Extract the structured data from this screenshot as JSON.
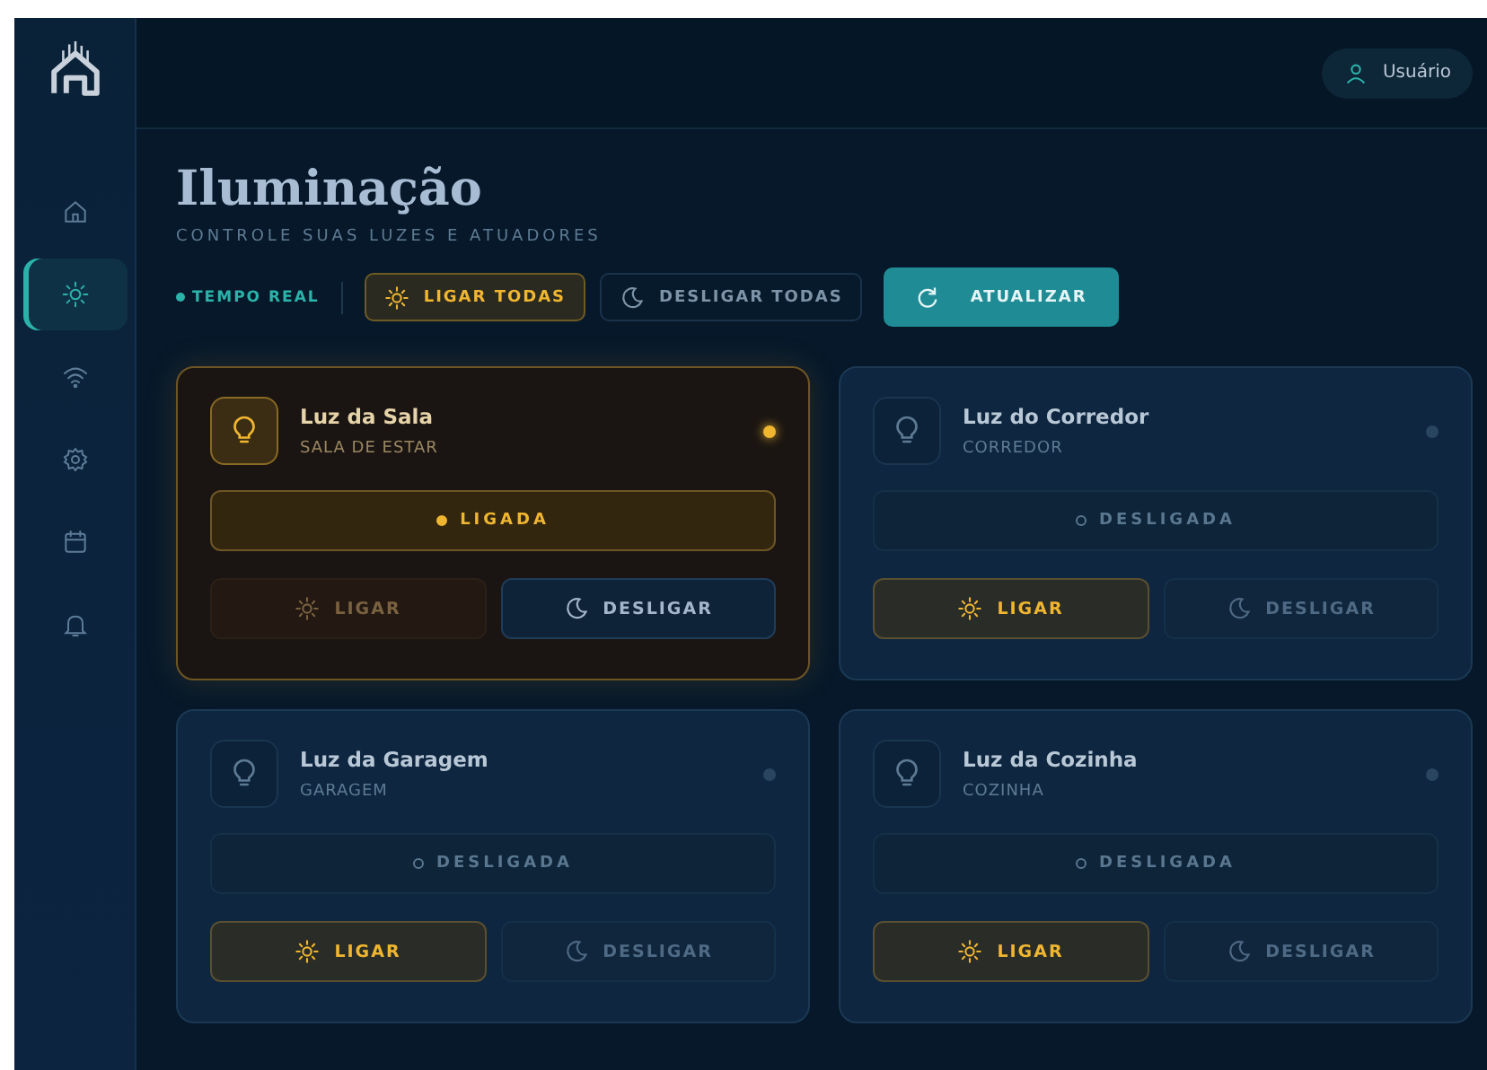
{
  "user_button": {
    "label": "Usuário"
  },
  "sidebar": {
    "items": [
      {
        "kind": "home",
        "selected": false
      },
      {
        "kind": "light",
        "selected": true
      },
      {
        "kind": "wifi",
        "selected": false
      },
      {
        "kind": "settings",
        "selected": false
      },
      {
        "kind": "calendar",
        "selected": false
      },
      {
        "kind": "bell",
        "selected": false
      }
    ]
  },
  "page": {
    "title": "Iluminação",
    "subtitle": "CONTROLE SUAS LUZES E ATUADORES"
  },
  "toolbar": {
    "live": "TEMPO REAL",
    "turn_all_on": "LIGAR TODAS",
    "turn_all_off": "DESLIGAR TODAS",
    "refresh": "ATUALIZAR"
  },
  "lights": [
    {
      "name": "Luz da Sala",
      "room": "SALA DE ESTAR",
      "on": true,
      "status": "LIGADA",
      "on_label": "LIGAR",
      "off_label": "DESLIGAR"
    },
    {
      "name": "Luz do Corredor",
      "room": "CORREDOR",
      "on": false,
      "status": "DESLIGADA",
      "on_label": "LIGAR",
      "off_label": "DESLIGAR"
    },
    {
      "name": "Luz da Garagem",
      "room": "GARAGEM",
      "on": false,
      "status": "DESLIGADA",
      "on_label": "LIGAR",
      "off_label": "DESLIGAR"
    },
    {
      "name": "Luz da Cozinha",
      "room": "COZINHA",
      "on": false,
      "status": "DESLIGADA",
      "on_label": "LIGAR",
      "off_label": "DESLIGAR"
    }
  ]
}
